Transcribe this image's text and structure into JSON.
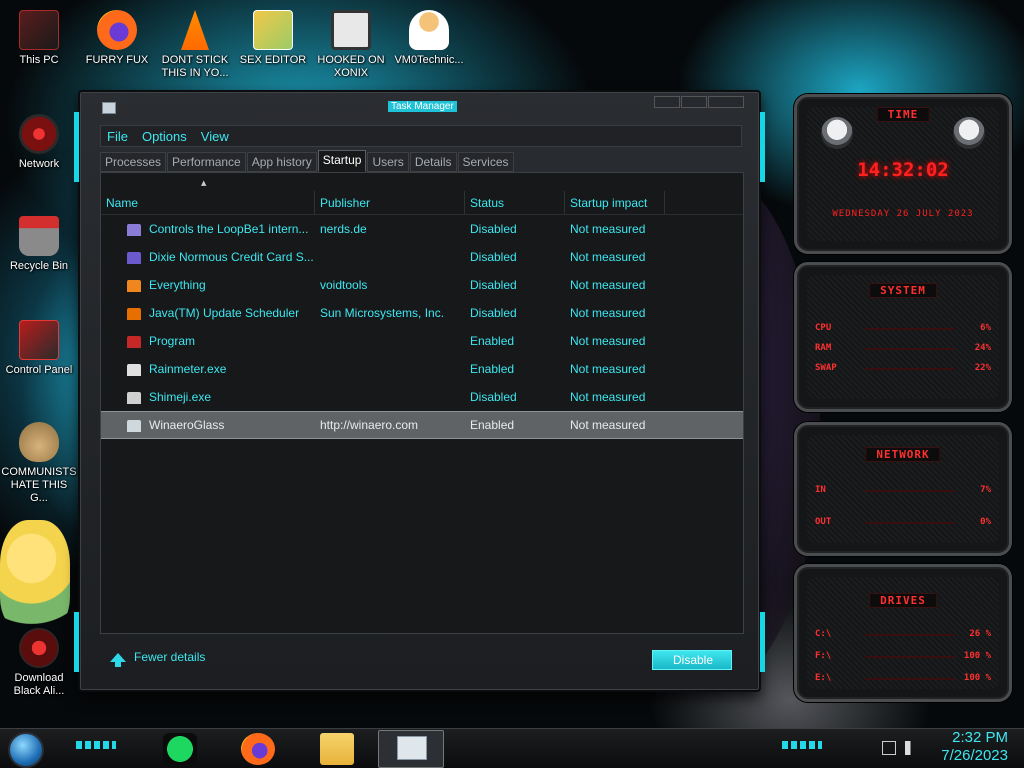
{
  "desktop": {
    "icons": [
      {
        "label": "This PC"
      },
      {
        "label": "FURRY FUX"
      },
      {
        "label": "DONT STICK THIS IN YO..."
      },
      {
        "label": "SEX EDITOR"
      },
      {
        "label": "HOOKED ON XONIX"
      },
      {
        "label": "VM0Technic..."
      },
      {
        "label": "Network"
      },
      {
        "label": "Recycle Bin"
      },
      {
        "label": "Control Panel"
      },
      {
        "label": "COMMUNISTS HATE THIS G..."
      },
      {
        "label": "Download Black Ali..."
      }
    ]
  },
  "window": {
    "title": "Task Manager",
    "menu": [
      "File",
      "Options",
      "View"
    ],
    "tabs": [
      "Processes",
      "Performance",
      "App history",
      "Startup",
      "Users",
      "Details",
      "Services"
    ],
    "active_tab": "Startup",
    "columns": [
      "Name",
      "Publisher",
      "Status",
      "Startup impact"
    ],
    "rows": [
      {
        "name": "Controls the LoopBe1 intern...",
        "publisher": "nerds.de",
        "status": "Disabled",
        "impact": "Not measured",
        "icon": "loopbe-icon",
        "icon_color": "#8a7bd6"
      },
      {
        "name": "Dixie Normous Credit Card S...",
        "publisher": "",
        "status": "Disabled",
        "impact": "Not measured",
        "icon": "credit-card-icon",
        "icon_color": "#6a5acd"
      },
      {
        "name": "Everything",
        "publisher": "voidtools",
        "status": "Disabled",
        "impact": "Not measured",
        "icon": "magnifier-icon",
        "icon_color": "#f0861e"
      },
      {
        "name": "Java(TM) Update Scheduler",
        "publisher": "Sun Microsystems, Inc.",
        "status": "Disabled",
        "impact": "Not measured",
        "icon": "java-icon",
        "icon_color": "#e76f00"
      },
      {
        "name": "Program",
        "publisher": "",
        "status": "Enabled",
        "impact": "Not measured",
        "icon": "program-icon",
        "icon_color": "#c62828"
      },
      {
        "name": "Rainmeter.exe",
        "publisher": "",
        "status": "Enabled",
        "impact": "Not measured",
        "icon": "raindrop-icon",
        "icon_color": "#e0e0e0"
      },
      {
        "name": "Shimeji.exe",
        "publisher": "",
        "status": "Disabled",
        "impact": "Not measured",
        "icon": "shimeji-icon",
        "icon_color": "#d0d0d0"
      },
      {
        "name": "WinaeroGlass",
        "publisher": "http://winaero.com",
        "status": "Enabled",
        "impact": "Not measured",
        "icon": "window-icon",
        "icon_color": "#cfd8dc"
      }
    ],
    "selected_row": 7,
    "footer": {
      "fewer_details": "Fewer details",
      "disable_button": "Disable"
    }
  },
  "widgets": {
    "time": {
      "header": "TIME",
      "clock": "14:32:02",
      "date": "WEDNESDAY 26 JULY 2023"
    },
    "system": {
      "header": "SYSTEM",
      "stats": [
        {
          "label": "CPU",
          "value": "6%"
        },
        {
          "label": "RAM",
          "value": "24%"
        },
        {
          "label": "SWAP",
          "value": "22%"
        }
      ]
    },
    "network": {
      "header": "NETWORK",
      "stats": [
        {
          "label": "IN",
          "value": "7%"
        },
        {
          "label": "OUT",
          "value": "0%"
        }
      ]
    },
    "drives": {
      "header": "DRIVES",
      "stats": [
        {
          "label": "C:\\",
          "value": "26 %"
        },
        {
          "label": "F:\\",
          "value": "100 %"
        },
        {
          "label": "E:\\",
          "value": "100 %"
        }
      ]
    }
  },
  "taskbar": {
    "time": "2:32 PM",
    "date": "7/26/2023"
  },
  "colors": {
    "accent": "#3ee7f0",
    "widget_red": "#ff2020"
  }
}
